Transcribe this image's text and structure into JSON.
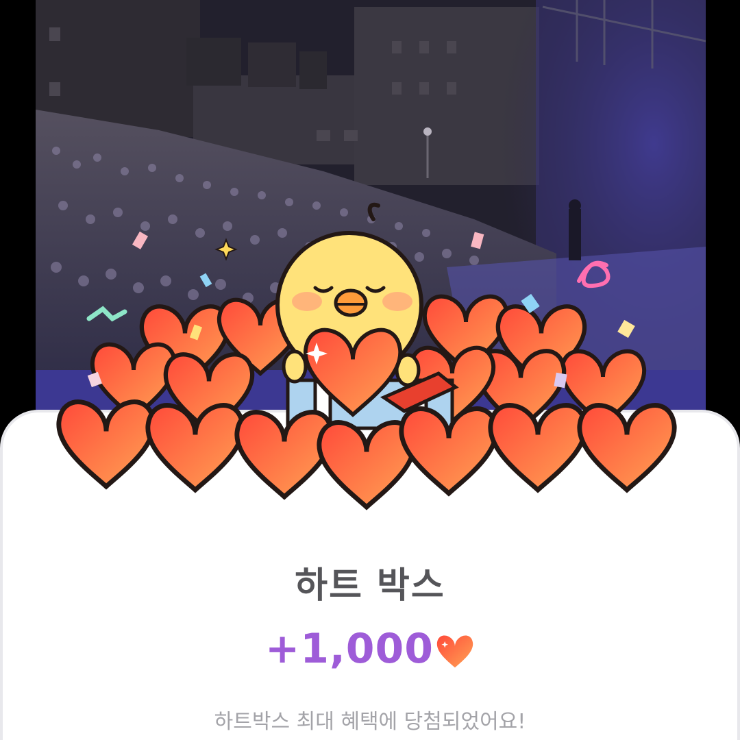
{
  "reward": {
    "title": "하트 박스",
    "amount": "+1,000",
    "currency_icon": "heart-icon",
    "message": "하트박스 최대 혜택에 당첨되었어요!"
  },
  "banner": {
    "scene": "outdoor-concert-photo"
  },
  "colors": {
    "accent": "#9e5cd8",
    "title": "#555559",
    "message": "#a3a3a8",
    "heart": "#ff5a3c",
    "stage_light": "#3c3892"
  }
}
